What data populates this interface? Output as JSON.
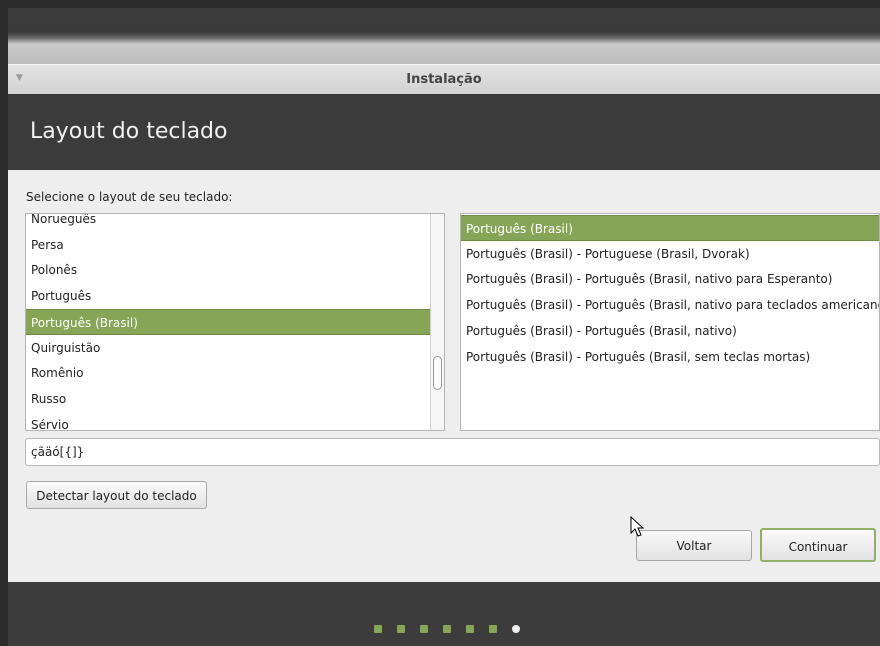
{
  "window": {
    "title": "Instalação"
  },
  "header": {
    "heading": "Layout do teclado"
  },
  "prompt": "Selecione o layout de seu teclado:",
  "layouts": [
    {
      "label": "Norueguês",
      "selected": false
    },
    {
      "label": "Persa",
      "selected": false
    },
    {
      "label": "Polonês",
      "selected": false
    },
    {
      "label": "Português",
      "selected": false
    },
    {
      "label": "Português (Brasil)",
      "selected": true
    },
    {
      "label": "Quirguistão",
      "selected": false
    },
    {
      "label": "Romênio",
      "selected": false
    },
    {
      "label": "Russo",
      "selected": false
    },
    {
      "label": "Sérvio",
      "selected": false
    }
  ],
  "variants": [
    {
      "label": "Português (Brasil)",
      "selected": true
    },
    {
      "label": "Português (Brasil) - Portuguese (Brasil, Dvorak)",
      "selected": false
    },
    {
      "label": "Português (Brasil) - Português (Brasil, nativo para Esperanto)",
      "selected": false
    },
    {
      "label": "Português (Brasil) - Português (Brasil, nativo para teclados americanos)",
      "selected": false
    },
    {
      "label": "Português (Brasil) - Português (Brasil, nativo)",
      "selected": false
    },
    {
      "label": "Português (Brasil) - Português (Brasil, sem teclas mortas)",
      "selected": false
    }
  ],
  "test_input": {
    "value": "çãäó[{]}"
  },
  "buttons": {
    "detect": "Detectar layout do teclado",
    "back": "Voltar",
    "continue": "Continuar"
  },
  "progress": {
    "total_steps": 7,
    "current_step": 7
  },
  "colors": {
    "accent": "#87a556",
    "header_bg": "#3b3b3b",
    "content_bg": "#eeeeee"
  }
}
